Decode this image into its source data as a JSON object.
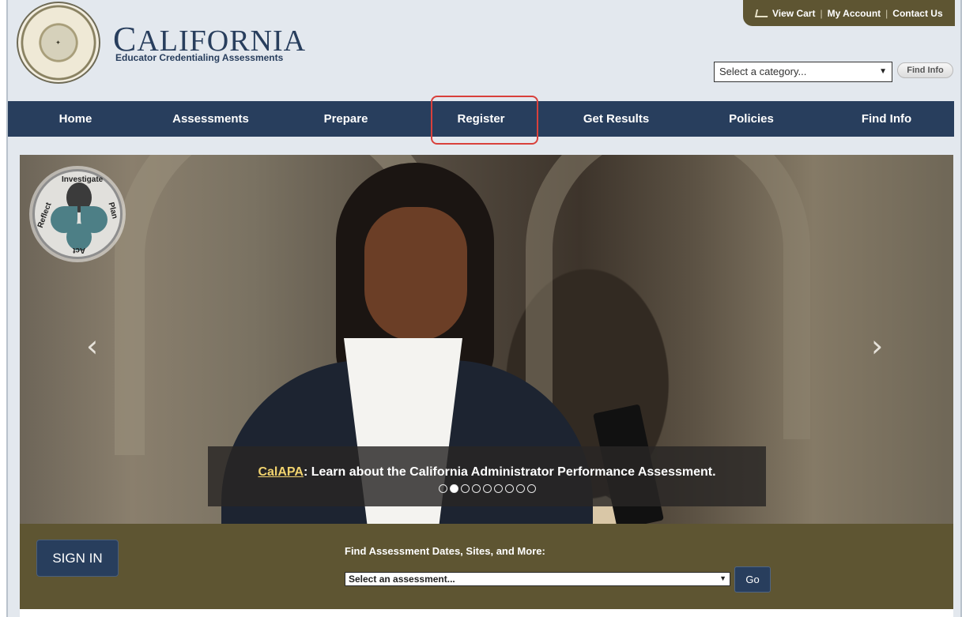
{
  "header": {
    "brand_first_letter": "C",
    "brand_rest": "ALIFORNIA",
    "brand_subtitle": "Educator Credentialing Assessments",
    "util_links": [
      "View Cart",
      "My Account",
      "Contact Us"
    ],
    "category_select": "Select a category...",
    "find_button": "Find Info"
  },
  "nav": {
    "items": [
      "Home",
      "Assessments",
      "Prepare",
      "Register",
      "Get Results",
      "Policies",
      "Find Info"
    ]
  },
  "hero": {
    "logo_labels": [
      "Investigate",
      "Plan",
      "Act",
      "Reflect"
    ],
    "caption_link": "CalAPA",
    "caption_text": ": Learn about the California Administrator Performance Assessment.",
    "slide_count": 9,
    "active_slide": 2,
    "prev_glyph": "‹",
    "next_glyph": "›"
  },
  "bottom": {
    "sign_in": "SIGN IN",
    "find_label": "Find Assessment Dates, Sites, and More:",
    "assessment_select": "Select an assessment...",
    "go": "Go"
  },
  "colors": {
    "navy": "#283e5d",
    "olive": "#5e5532",
    "highlight": "#d9403b",
    "caption_link": "#f1d36e"
  }
}
